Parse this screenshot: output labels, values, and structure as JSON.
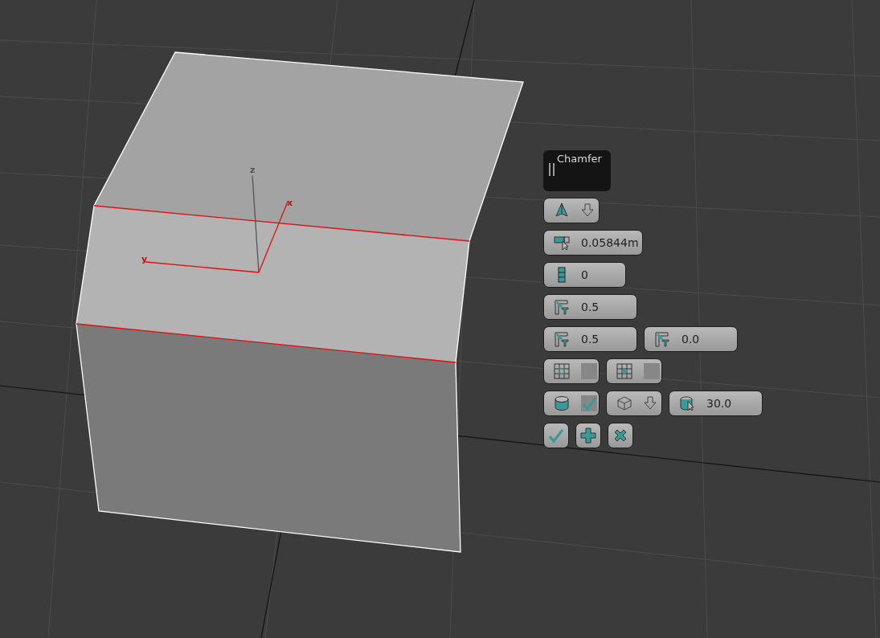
{
  "viewport": {
    "axis_labels": [
      {
        "kind": "z",
        "text": "z"
      },
      {
        "kind": "x",
        "text": "x"
      },
      {
        "kind": "y",
        "text": "y"
      }
    ]
  },
  "caddy": {
    "title": "Chamfer",
    "rows": [
      {
        "controls": [
          {
            "kind": "dropdown"
          }
        ]
      },
      {
        "controls": [
          {
            "kind": "spinner",
            "value": "0.05844m"
          }
        ]
      },
      {
        "controls": [
          {
            "kind": "spinner",
            "value": "0"
          }
        ]
      },
      {
        "controls": [
          {
            "kind": "spinner",
            "value": "0.5"
          }
        ]
      },
      {
        "controls": [
          {
            "kind": "spinner",
            "value": "0.5"
          },
          {
            "kind": "spinner",
            "value": "0.0"
          }
        ]
      },
      {
        "controls": [
          {
            "kind": "checkbox",
            "checked": false
          },
          {
            "kind": "checkbox",
            "checked": false
          }
        ]
      },
      {
        "controls": [
          {
            "kind": "checkbox",
            "checked": true
          },
          {
            "kind": "dropdown"
          },
          {
            "kind": "spinner",
            "value": "30.0"
          }
        ]
      },
      {
        "controls": [
          {
            "kind": "button"
          },
          {
            "kind": "button"
          },
          {
            "kind": "button"
          }
        ]
      }
    ]
  }
}
